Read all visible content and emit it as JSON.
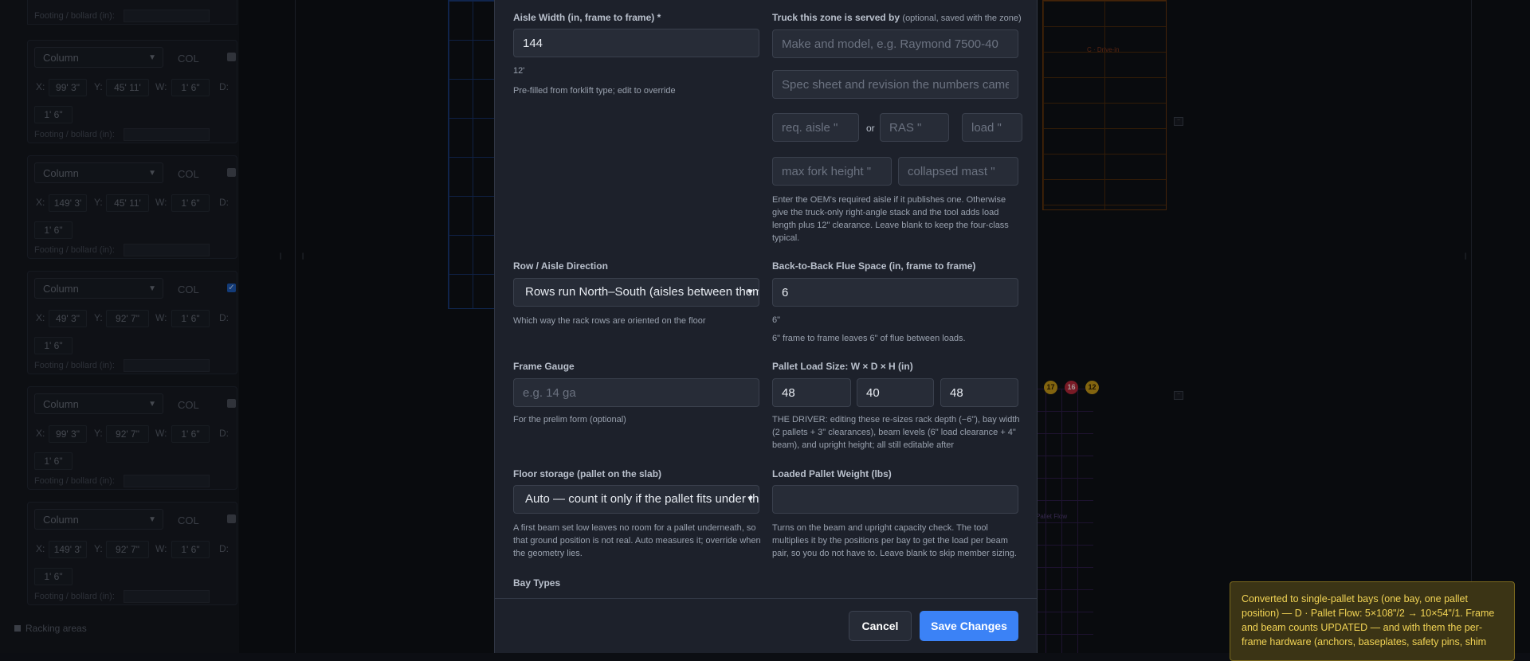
{
  "sidebar": {
    "footing_label": "Footing / bollard (in):",
    "column_cards": [
      {
        "type": "Column",
        "tag": "COL",
        "checked": false,
        "x": "99' 3\"",
        "y": "45' 11'",
        "w": "1' 6\"",
        "d": "1' 6\""
      },
      {
        "type": "Column",
        "tag": "COL",
        "checked": false,
        "x": "149' 3'",
        "y": "45' 11'",
        "w": "1' 6\"",
        "d": "1' 6\""
      },
      {
        "type": "Column",
        "tag": "COL",
        "checked": true,
        "x": "49' 3\"",
        "y": "92' 7\"",
        "w": "1' 6\"",
        "d": "1' 6\""
      },
      {
        "type": "Column",
        "tag": "COL",
        "checked": false,
        "x": "99' 3\"",
        "y": "92' 7\"",
        "w": "1' 6\"",
        "d": "1' 6\""
      },
      {
        "type": "Column",
        "tag": "COL",
        "checked": false,
        "x": "149' 3'",
        "y": "92' 7\"",
        "w": "1' 6\"",
        "d": "1' 6\""
      }
    ],
    "labels": {
      "x": "X:",
      "y": "Y:",
      "w": "W:",
      "d": "D:"
    },
    "racking_areas": "Racking areas"
  },
  "canvas": {
    "zone_label": "C · Drive-in",
    "pallet_flow_label": "Pallet Flow",
    "badges": [
      "17",
      "16",
      "12"
    ],
    "minus": "−"
  },
  "modal": {
    "aisle_width": {
      "label": "Aisle Width (in, frame to frame) *",
      "value": "144",
      "converted": "12'",
      "help": "Pre-filled from forklift type; edit to override"
    },
    "truck": {
      "label": "Truck this zone is served by",
      "label_suffix": "(optional, saved with the zone)",
      "make_placeholder": "Make and model, e.g. Raymond 7500-40",
      "spec_placeholder": "Spec sheet and revision the numbers came from",
      "req_aisle_placeholder": "req. aisle \"",
      "or": "or",
      "ras_placeholder": "RAS \"",
      "load_placeholder": "load \"",
      "max_fork_placeholder": "max fork height \"",
      "collapsed_mast_placeholder": "collapsed mast \"",
      "help": "Enter the OEM's required aisle if it publishes one. Otherwise give the truck-only right-angle stack and the tool adds load length plus 12\" clearance. Leave blank to keep the four-class typical."
    },
    "row_direction": {
      "label": "Row / Aisle Direction",
      "value": "Rows run North–South (aisles between them run N–S)",
      "help": "Which way the rack rows are oriented on the floor"
    },
    "flue": {
      "label": "Back-to-Back Flue Space (in, frame to frame)",
      "value": "6",
      "converted": "6\"",
      "help": "6\" frame to frame leaves 6\" of flue between loads."
    },
    "frame_gauge": {
      "label": "Frame Gauge",
      "placeholder": "e.g. 14 ga",
      "help": "For the prelim form (optional)"
    },
    "pallet_size": {
      "label": "Pallet Load Size: W × D × H (in)",
      "w": "48",
      "d": "40",
      "h": "48",
      "help": "THE DRIVER: editing these re-sizes rack depth (−6\"), bay width (2 pallets + 3\" clearances), beam levels (6\" load clearance + 4\" beam), and upright height; all still editable after"
    },
    "floor_storage": {
      "label": "Floor storage (pallet on the slab)",
      "value": "Auto — count it only if the pallet fits under the first beam",
      "help": "A first beam set low leaves no room for a pallet underneath, so that ground position is not real. Auto measures it; override when the geometry lies."
    },
    "pallet_weight": {
      "label": "Loaded Pallet Weight (lbs)",
      "value": "",
      "help": "Turns on the beam and upright capacity check. The tool multiplies it by the positions per bay to get the load per beam pair, so you do not have to. Leave blank to skip member sizing."
    },
    "bay_types_label": "Bay Types",
    "cancel_label": "Cancel",
    "save_label": "Save Changes"
  },
  "toast": {
    "text": "Converted to single-pallet bays (one bay, one pallet position) — D · Pallet Flow: 5×108\"/2 → 10×54\"/1. Frame and beam counts UPDATED — and with them the per-frame hardware (anchors, baseplates, safety pins, shim"
  },
  "colors": {
    "modal_bg": "#1d212b",
    "accent": "#3b82f6",
    "toast_bg": "#3b3415",
    "toast_text": "#f2d455",
    "checkbox_on": "#1e5bb8"
  },
  "icons": {
    "select_chevron": "chevron-down-icon",
    "checkbox": "checkbox-icon"
  }
}
